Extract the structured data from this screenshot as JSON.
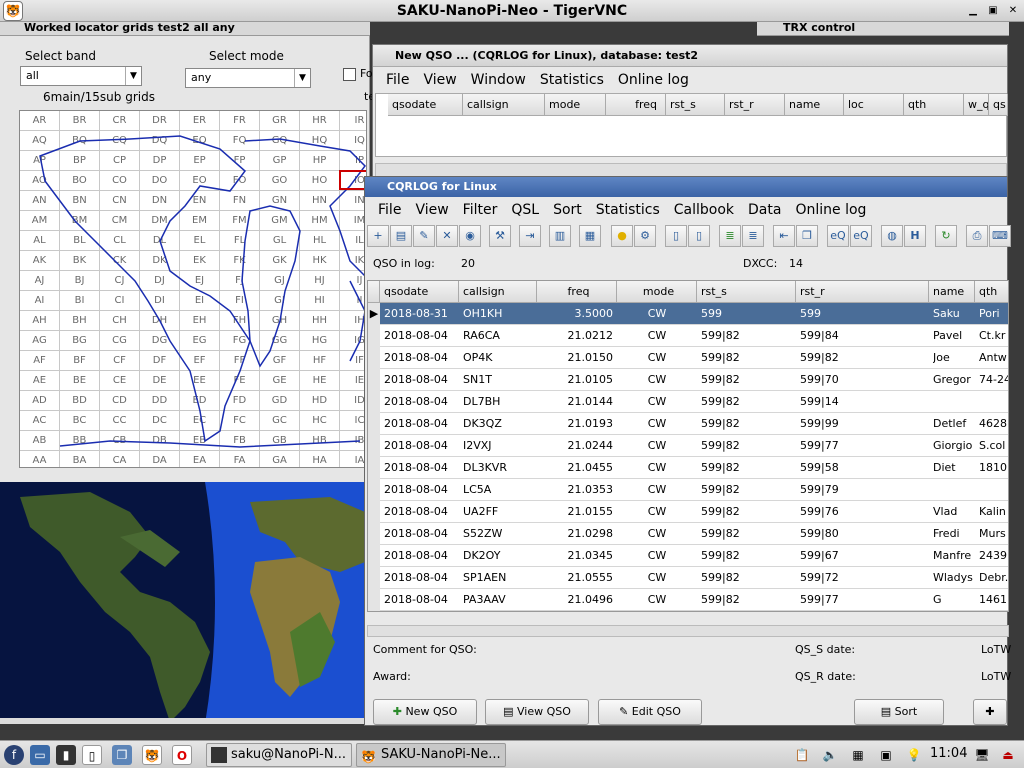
{
  "vnc": {
    "title": "SAKU-NanoPi-Neo - TigerVNC"
  },
  "grid_window": {
    "title": "Worked locator grids test2 all any",
    "band_label": "Select band",
    "band_value": "all",
    "mode_label": "Select mode",
    "mode_value": "any",
    "sub_label": "6main/15sub grids",
    "fo_label": "Fo",
    "te_label": "te",
    "rows": [
      [
        "AR",
        "BR",
        "CR",
        "DR",
        "ER",
        "FR",
        "GR",
        "HR",
        "IR"
      ],
      [
        "AQ",
        "BQ",
        "CQ",
        "DQ",
        "EQ",
        "FQ",
        "GQ",
        "HQ",
        "IQ"
      ],
      [
        "AP",
        "BP",
        "CP",
        "DP",
        "EP",
        "FP",
        "GP",
        "HP",
        "IP"
      ],
      [
        "AO",
        "BO",
        "CO",
        "DO",
        "EO",
        "FO",
        "GO",
        "HO",
        "IO"
      ],
      [
        "AN",
        "BN",
        "CN",
        "DN",
        "EN",
        "FN",
        "GN",
        "HN",
        "IN"
      ],
      [
        "AM",
        "BM",
        "CM",
        "DM",
        "EM",
        "FM",
        "GM",
        "HM",
        "IM"
      ],
      [
        "AL",
        "BL",
        "CL",
        "DL",
        "EL",
        "FL",
        "GL",
        "HL",
        "IL"
      ],
      [
        "AK",
        "BK",
        "CK",
        "DK",
        "EK",
        "FK",
        "GK",
        "HK",
        "IK"
      ],
      [
        "AJ",
        "BJ",
        "CJ",
        "DJ",
        "EJ",
        "FJ",
        "GJ",
        "HJ",
        "IJ"
      ],
      [
        "AI",
        "BI",
        "CI",
        "DI",
        "EI",
        "FI",
        "GI",
        "HI",
        "II"
      ],
      [
        "AH",
        "BH",
        "CH",
        "DH",
        "EH",
        "FH",
        "GH",
        "HH",
        "IH"
      ],
      [
        "AG",
        "BG",
        "CG",
        "DG",
        "EG",
        "FG",
        "GG",
        "HG",
        "IG"
      ],
      [
        "AF",
        "BF",
        "CF",
        "DF",
        "EF",
        "FF",
        "GF",
        "HF",
        "IF"
      ],
      [
        "AE",
        "BE",
        "CE",
        "DE",
        "EE",
        "FE",
        "GE",
        "HE",
        "IE"
      ],
      [
        "AD",
        "BD",
        "CD",
        "DD",
        "ED",
        "FD",
        "GD",
        "HD",
        "ID"
      ],
      [
        "AC",
        "BC",
        "CC",
        "DC",
        "EC",
        "FC",
        "GC",
        "HC",
        "IC"
      ],
      [
        "AB",
        "BB",
        "CB",
        "DB",
        "EB",
        "FB",
        "GB",
        "HB",
        "IB"
      ],
      [
        "AA",
        "BA",
        "CA",
        "DA",
        "EA",
        "FA",
        "GA",
        "HA",
        "IA"
      ]
    ]
  },
  "trx": {
    "title": "TRX control"
  },
  "new_qso": {
    "title": "New QSO ... (CQRLOG for Linux), database: test2",
    "menu": [
      "File",
      "View",
      "Window",
      "Statistics",
      "Online log"
    ],
    "columns": [
      "qsodate",
      "callsign",
      "mode",
      "freq",
      "rst_s",
      "rst_r",
      "name",
      "loc",
      "qth",
      "w_q",
      "qs"
    ]
  },
  "cqrlog": {
    "title": "CQRLOG for Linux",
    "menu": [
      "File",
      "View",
      "Filter",
      "QSL",
      "Sort",
      "Statistics",
      "Callbook",
      "Data",
      "Online log"
    ],
    "qso_in_log_label": "QSO in log:",
    "qso_in_log": "20",
    "dxcc_label": "DXCC:",
    "dxcc": "14",
    "columns": [
      "qsodate",
      "callsign",
      "freq",
      "mode",
      "rst_s",
      "rst_r",
      "name",
      "qth"
    ],
    "rows": [
      [
        "2018-08-31",
        "OH1KH",
        "3.5000",
        "CW",
        "599",
        "599",
        "Saku",
        "Pori"
      ],
      [
        "2018-08-04",
        "RA6CA",
        "21.0212",
        "CW",
        "599|82",
        "599|84",
        "Pavel",
        "Ct.kr"
      ],
      [
        "2018-08-04",
        "OP4K",
        "21.0150",
        "CW",
        "599|82",
        "599|82",
        "Joe",
        "Antw"
      ],
      [
        "2018-08-04",
        "SN1T",
        "21.0105",
        "CW",
        "599|82",
        "599|70",
        "Gregor",
        "74-24"
      ],
      [
        "2018-08-04",
        "DL7BH",
        "21.0144",
        "CW",
        "599|82",
        "599|14",
        "",
        ""
      ],
      [
        "2018-08-04",
        "DK3QZ",
        "21.0193",
        "CW",
        "599|82",
        "599|99",
        "Detlef",
        "4628"
      ],
      [
        "2018-08-04",
        "I2VXJ",
        "21.0244",
        "CW",
        "599|82",
        "599|77",
        "Giorgio",
        "S.col"
      ],
      [
        "2018-08-04",
        "DL3KVR",
        "21.0455",
        "CW",
        "599|82",
        "599|58",
        "Diet",
        "1810"
      ],
      [
        "2018-08-04",
        "LC5A",
        "21.0353",
        "CW",
        "599|82",
        "599|79",
        "",
        ""
      ],
      [
        "2018-08-04",
        "UA2FF",
        "21.0155",
        "CW",
        "599|82",
        "599|76",
        "Vlad",
        "Kalin"
      ],
      [
        "2018-08-04",
        "S52ZW",
        "21.0298",
        "CW",
        "599|82",
        "599|80",
        "Fredi",
        "Murs"
      ],
      [
        "2018-08-04",
        "DK2OY",
        "21.0345",
        "CW",
        "599|82",
        "599|67",
        "Manfre",
        "2439"
      ],
      [
        "2018-08-04",
        "SP1AEN",
        "21.0555",
        "CW",
        "599|82",
        "599|72",
        "Wladys",
        "Debr."
      ],
      [
        "2018-08-04",
        "PA3AAV",
        "21.0496",
        "CW",
        "599|82",
        "599|77",
        "G",
        "1461"
      ]
    ],
    "comment_label": "Comment for QSO:",
    "award_label": "Award:",
    "qs_s_label": "QS_S date:",
    "qs_r_label": "QS_R date:",
    "lotw1": "LoTW",
    "lotw2": "LoTW",
    "buttons": {
      "new_qso": "New QSO",
      "view_qso": "View QSO",
      "edit_qso": "Edit QSO",
      "sort": "Sort"
    }
  },
  "taskbar": {
    "tasks": [
      "saku@NanoPi-N...",
      "SAKU-NanoPi-Ne..."
    ],
    "clock": "11:04"
  }
}
